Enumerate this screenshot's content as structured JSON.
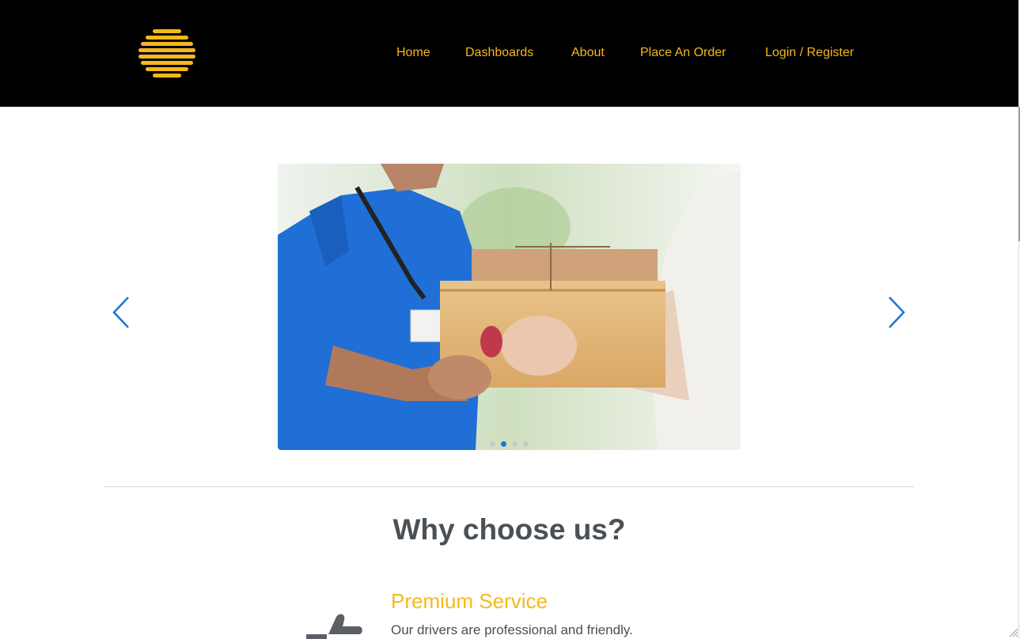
{
  "header": {
    "logo_icon": "striped-hexagon-logo-icon",
    "brand_color": "#f5b81c",
    "nav": {
      "home": "Home",
      "dashboards": "Dashboards",
      "about": "About",
      "place_order": "Place An Order",
      "login": "Login / Register"
    }
  },
  "carousel": {
    "image_subject": "courier-handing-boxes-photo",
    "prev_icon": "chevron-left-icon",
    "next_icon": "chevron-right-icon",
    "slide_count": 4,
    "active_slide": 2,
    "accent_color": "#1976d2"
  },
  "why": {
    "title": "Why choose us?"
  },
  "features": [
    {
      "icon": "thumbs-up-icon",
      "title": "Premium Service",
      "text": "Our drivers are professional and friendly."
    }
  ]
}
